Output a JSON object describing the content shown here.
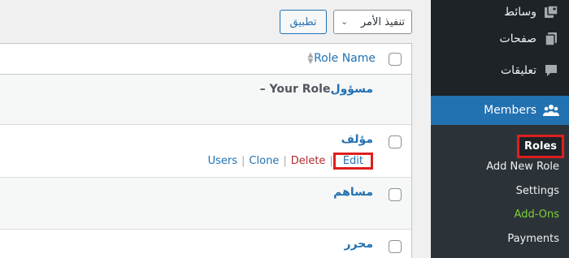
{
  "sidebar": {
    "items": [
      {
        "label": "وسائط",
        "icon": "media-icon"
      },
      {
        "label": "صفحات",
        "icon": "pages-icon"
      },
      {
        "label": "تعليقات",
        "icon": "comments-icon"
      },
      {
        "label": "Members",
        "icon": "members-icon"
      }
    ],
    "submenu": [
      "Roles",
      "Add New Role",
      "Settings",
      "Add-Ons",
      "Payments"
    ]
  },
  "bulk": {
    "action": "تنفيذ الأمر",
    "apply": "تطبيق"
  },
  "table": {
    "column_header": "Role Name",
    "rows": [
      {
        "title": "مسؤول",
        "suffix": " – Your Role"
      },
      {
        "title": "مؤلف"
      },
      {
        "title": "مساهم"
      },
      {
        "title": "محرر"
      }
    ],
    "row_actions": {
      "users": "Users",
      "clone": "Clone",
      "delete": "Delete",
      "edit": "Edit",
      "separator": "|"
    }
  },
  "colors": {
    "sidebar_bg": "#1d2327",
    "submenu_bg": "#2c3338",
    "accent": "#2271b1",
    "delete": "#b32d2e",
    "addons": "#7ad03a",
    "highlight_box": "#e01e1e"
  }
}
